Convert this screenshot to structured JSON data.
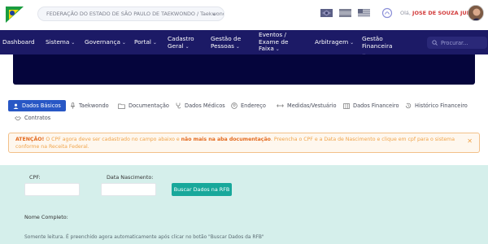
{
  "header": {
    "org_selected": "FEDERAÇÃO DO ESTADO DE SÃO PAULO DE TAEKWONDO / Taekwondo",
    "greeting_prefix": "Olá, ",
    "user_name": "JOSE DE SOUZA JUNIOR",
    "flags": [
      "flag-icon-br",
      "flag-icon-es",
      "flag-icon-us"
    ]
  },
  "nav": {
    "items": [
      {
        "label": "Dashboard",
        "dropdown": false
      },
      {
        "label": "Sistema",
        "dropdown": true
      },
      {
        "label": "Governança",
        "dropdown": true
      },
      {
        "label": "Portal",
        "dropdown": true
      },
      {
        "label": "Cadastro Geral",
        "dropdown": true
      },
      {
        "label": "Gestão de Pessoas",
        "dropdown": true
      },
      {
        "label": "Eventos / Exame de Faixa",
        "dropdown": true
      },
      {
        "label": "Arbitragem",
        "dropdown": true
      },
      {
        "label": "Gestão Financeira",
        "dropdown": true
      }
    ],
    "search_placeholder": "Procurar..."
  },
  "tabs": [
    {
      "label": "Dados Básicos",
      "icon": "person-icon",
      "active": true
    },
    {
      "label": "Taekwondo",
      "icon": "microphone-icon",
      "active": false
    },
    {
      "label": "Documentação",
      "icon": "folder-icon",
      "active": false
    },
    {
      "label": "Dados Médicos",
      "icon": "stethoscope-icon",
      "active": false
    },
    {
      "label": "Endereço",
      "icon": "user-outline-icon",
      "active": false
    },
    {
      "label": "Medidas/Vestuário",
      "icon": "ruler-icon",
      "active": false
    },
    {
      "label": "Dados Financeiro",
      "icon": "columns-icon",
      "active": false
    },
    {
      "label": "Histórico Financeiro",
      "icon": "history-icon",
      "active": false
    },
    {
      "label": "Contratos",
      "icon": "handshake-icon",
      "active": false
    }
  ],
  "alert": {
    "prefix": "ATENÇÃO!",
    "text1": " O CPF agora deve ser cadastrado no campo abaixo e ",
    "bold": "não mais na aba documentação",
    "text2": ". Preencha o CPF e a Data de Nascimento e clique em cpf para o sistema conforme na Receita Federal."
  },
  "form": {
    "cpf_label": "CPF:",
    "birth_label": "Data Nascimento:",
    "cpf_value": "",
    "birth_value": "",
    "search_button": "Buscar Dados na RFB",
    "fullname_label": "Nome Completo:",
    "readonly_note": "Somente leitura. É preenchido agora automaticamente após clicar no botão \"Buscar Dados da RFB\""
  },
  "colors": {
    "navbar": "#1c1a66",
    "banner": "#05053c",
    "active_tab": "#2857c5",
    "alert_text": "#f0a44a",
    "form_bg": "#d5efeb",
    "button": "#18a89b",
    "user_name": "#d23b3b"
  }
}
